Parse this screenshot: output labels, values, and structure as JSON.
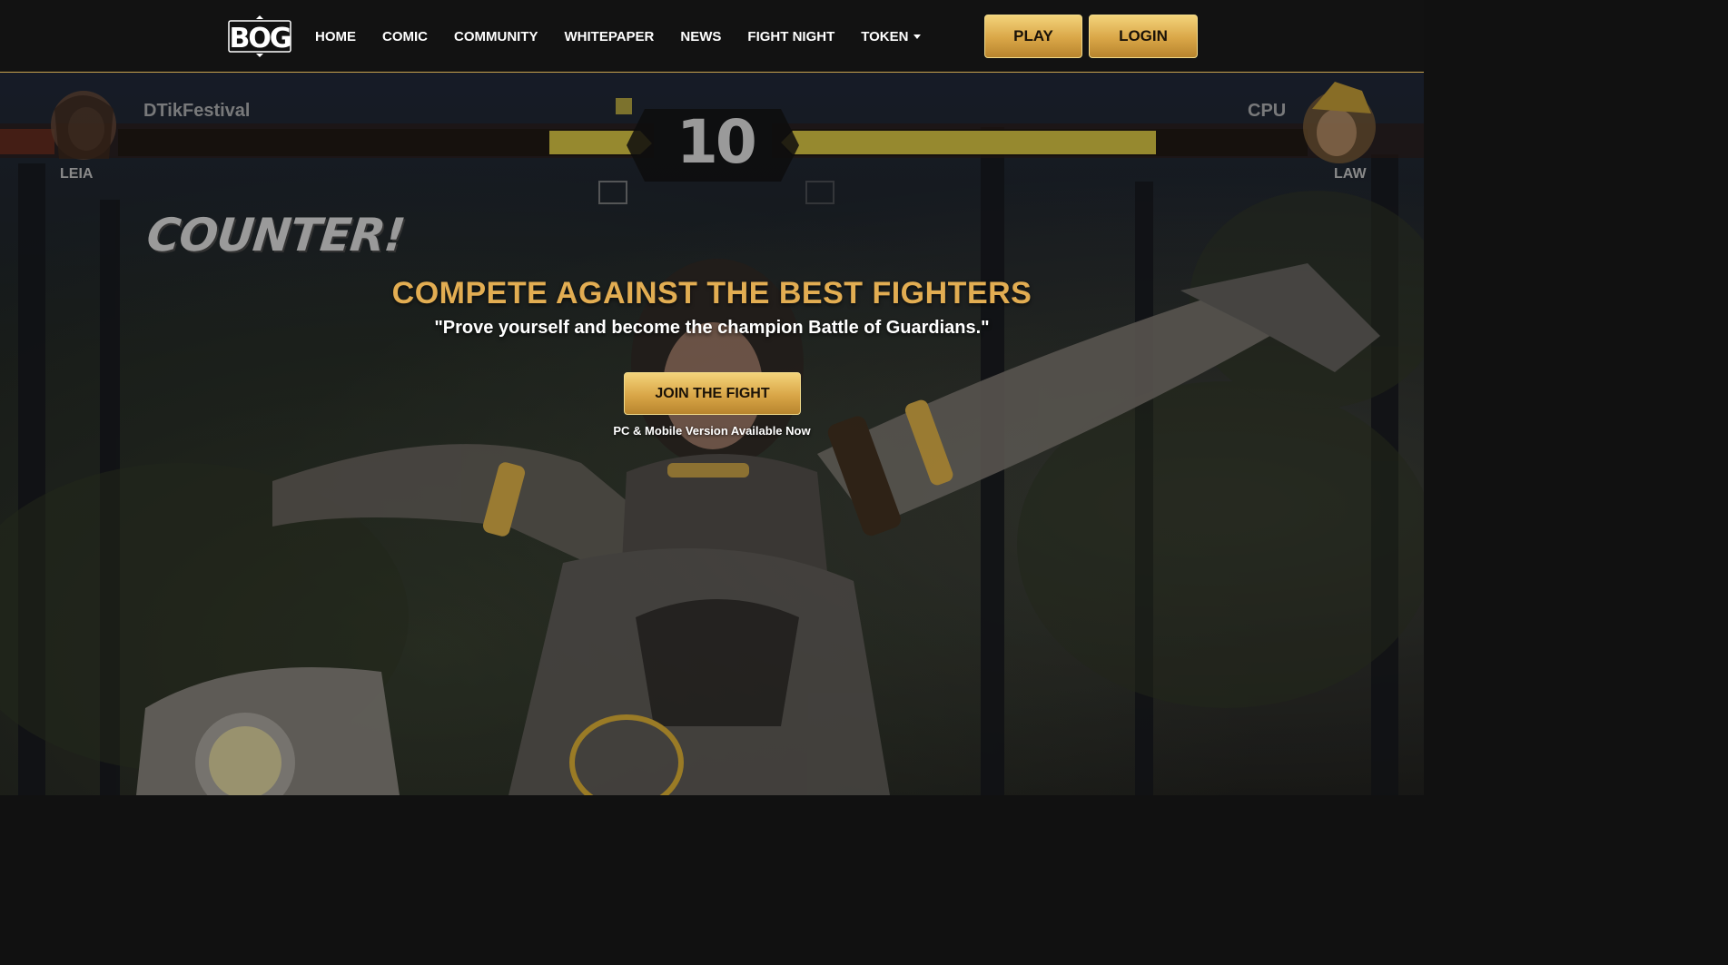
{
  "brand": {
    "logo_text": "BOG"
  },
  "nav": {
    "items": [
      {
        "label": "HOME"
      },
      {
        "label": "COMIC"
      },
      {
        "label": "COMMUNITY"
      },
      {
        "label": "WHITEPAPER"
      },
      {
        "label": "NEWS"
      },
      {
        "label": "FIGHT NIGHT"
      },
      {
        "label": "TOKEN"
      }
    ],
    "play_label": "PLAY",
    "login_label": "LOGIN"
  },
  "hud": {
    "player_name": "DTikFestival",
    "opponent_name": "CPU",
    "player_character": "LEIA",
    "opponent_character": "LAW",
    "timer": "10",
    "combo_text": "COUNTER!"
  },
  "hero": {
    "title": "COMPETE AGAINST THE BEST FIGHTERS",
    "subtitle": "\"Prove yourself and become the champion Battle of Guardians.\"",
    "cta_label": "JOIN THE FIGHT",
    "availability": "PC & Mobile Version Available Now"
  },
  "colors": {
    "gold": "#e2ad52",
    "button_gold": "#d9a647",
    "nav_bg": "#121212",
    "health_bar": "#b8a83a"
  }
}
